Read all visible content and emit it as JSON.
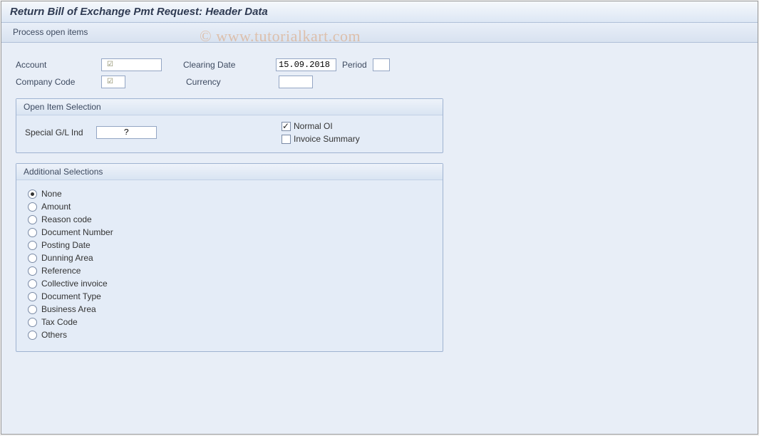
{
  "title": "Return Bill of Exchange Pmt Request: Header Data",
  "toolbar": {
    "process": "Process open items"
  },
  "watermark": "© www.tutorialkart.com",
  "fields": {
    "account_label": "Account",
    "company_code_label": "Company Code",
    "clearing_date_label": "Clearing Date",
    "clearing_date_value": "15.09.2018",
    "period_label": "Period",
    "currency_label": "Currency"
  },
  "group_open": {
    "title": "Open Item Selection",
    "special_gl_label": "Special G/L Ind",
    "special_gl_value": "?",
    "normal_oi_label": "Normal OI",
    "normal_oi_checked": true,
    "invoice_summary_label": "Invoice Summary",
    "invoice_summary_checked": false
  },
  "group_additional": {
    "title": "Additional Selections",
    "options": [
      {
        "label": "None",
        "checked": true
      },
      {
        "label": "Amount",
        "checked": false
      },
      {
        "label": "Reason code",
        "checked": false
      },
      {
        "label": "Document Number",
        "checked": false
      },
      {
        "label": "Posting Date",
        "checked": false
      },
      {
        "label": "Dunning Area",
        "checked": false
      },
      {
        "label": "Reference",
        "checked": false
      },
      {
        "label": "Collective invoice",
        "checked": false
      },
      {
        "label": "Document Type",
        "checked": false
      },
      {
        "label": "Business Area",
        "checked": false
      },
      {
        "label": "Tax Code",
        "checked": false
      },
      {
        "label": "Others",
        "checked": false
      }
    ]
  }
}
